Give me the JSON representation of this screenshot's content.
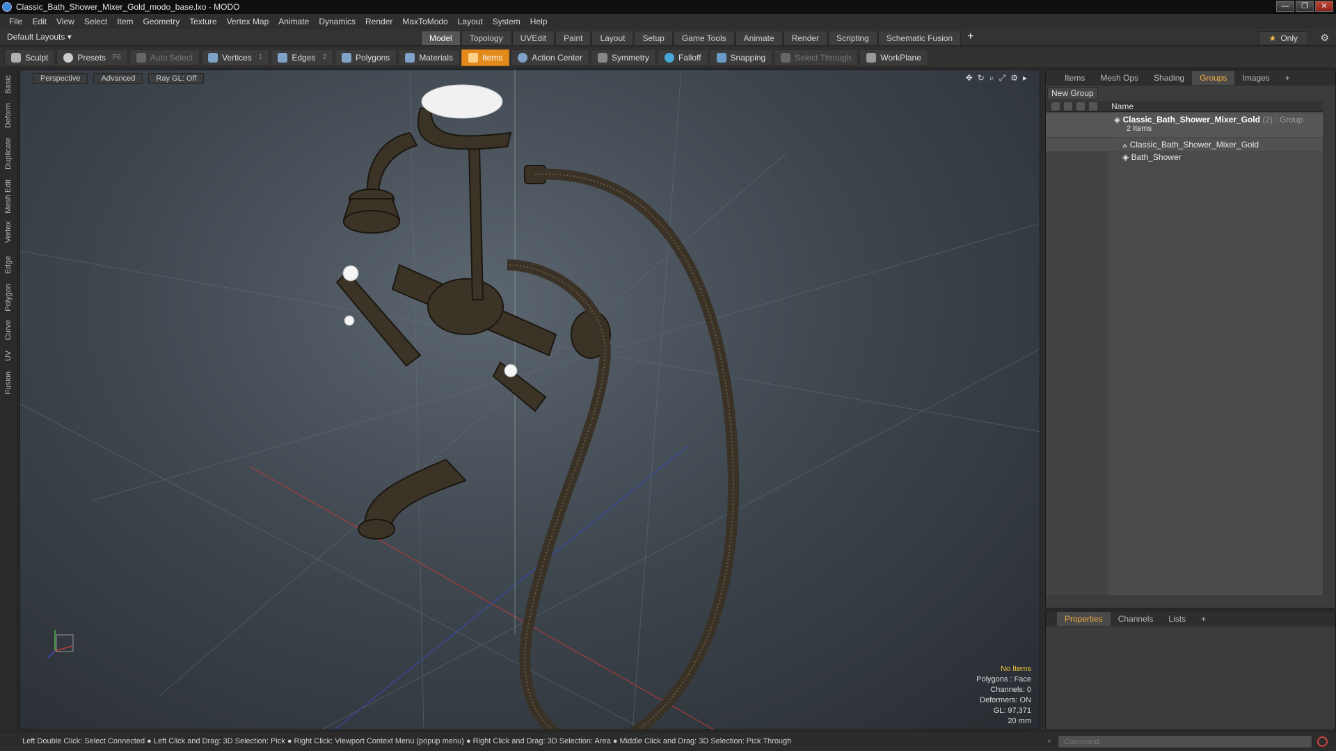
{
  "window": {
    "title": "Classic_Bath_Shower_Mixer_Gold_modo_base.lxo - MODO",
    "minimize": "—",
    "maximize": "❐",
    "close": "✕"
  },
  "menu": [
    "File",
    "Edit",
    "View",
    "Select",
    "Item",
    "Geometry",
    "Texture",
    "Vertex Map",
    "Animate",
    "Dynamics",
    "Render",
    "MaxToModo",
    "Layout",
    "System",
    "Help"
  ],
  "layout": {
    "preset": "Default Layouts ▾",
    "tabs": [
      "Model",
      "Topology",
      "UVEdit",
      "Paint",
      "Layout",
      "Setup",
      "Game Tools",
      "Animate",
      "Render",
      "Scripting",
      "Schematic Fusion"
    ],
    "active_tab": "Model",
    "plus": "+",
    "only_label": "Only"
  },
  "toolbar": {
    "sculpt": "Sculpt",
    "presets": "Presets",
    "presets_key": "F6",
    "auto_select": "Auto Select",
    "vertices": "Vertices",
    "vertices_key": "1",
    "edges": "Edges",
    "edges_key": "2",
    "polygons": "Polygons",
    "materials": "Materials",
    "items": "Items",
    "action_center": "Action Center",
    "symmetry": "Symmetry",
    "falloff": "Falloff",
    "snapping": "Snapping",
    "select_through": "Select Through",
    "workplane": "WorkPlane"
  },
  "left_tabs": [
    "Basic",
    "Deform",
    "Duplicate",
    "Mesh Edit",
    "Vertex",
    "Edge",
    "Polygon",
    "Curve",
    "UV",
    "Fusion"
  ],
  "viewport": {
    "perspective": "Perspective",
    "advanced": "Advanced",
    "raygl": "Ray GL: Off",
    "info": {
      "no_items": "No Items",
      "polygons": "Polygons : Face",
      "channels": "Channels: 0",
      "deformers": "Deformers: ON",
      "gl": "GL: 97,371",
      "scale": "20 mm"
    }
  },
  "rpanel": {
    "tabs": [
      "Items",
      "Mesh Ops",
      "Shading",
      "Groups",
      "Images"
    ],
    "active_tab": "Groups",
    "plus": "+",
    "new_group": "New Group",
    "col_name": "Name",
    "group": {
      "name": "Classic_Bath_Shower_Mixer_Gold",
      "count": "(2)",
      "type": ": Group",
      "sub": "2 Items"
    },
    "items": [
      "Classic_Bath_Shower_Mixer_Gold",
      "Bath_Shower"
    ]
  },
  "ppanel": {
    "tabs": [
      "Properties",
      "Channels",
      "Lists"
    ],
    "active_tab": "Properties",
    "plus": "+"
  },
  "status": {
    "hints": "Left Double Click: Select Connected ● Left Click and Drag: 3D Selection: Pick ● Right Click: Viewport Context Menu (popup menu) ● Right Click and Drag: 3D Selection: Area ● Middle Click and Drag: 3D Selection: Pick Through",
    "command_placeholder": "Command"
  },
  "colors": {
    "accent": "#e38a1c",
    "highlight": "#f0a840",
    "metal": "#3a3226"
  }
}
